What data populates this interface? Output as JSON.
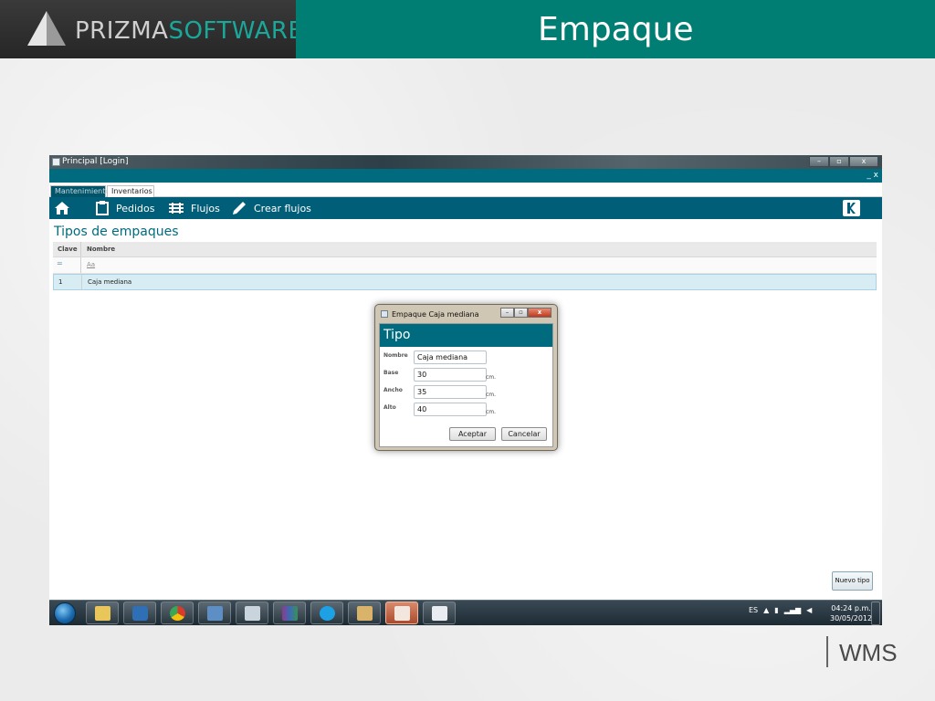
{
  "slide": {
    "logo_prefix": "PRIZMA",
    "logo_accent": "SOFTWARE",
    "title": "Empaque",
    "footer_brand": "WMS",
    "colors": {
      "teal_header": "#007e74",
      "app_teal": "#006b7e",
      "logo_bg": "#2e2e2e"
    }
  },
  "window": {
    "title": "Principal [Login]",
    "mini_controls": "_ x",
    "controls": [
      "minimize-icon",
      "maximize-icon",
      "close-icon"
    ]
  },
  "tabs": [
    {
      "label": "Mantenimiento",
      "active": true
    },
    {
      "label": "Inventarios",
      "active": false
    }
  ],
  "toolbar": {
    "items": [
      {
        "label": "",
        "icon": "home-icon"
      },
      {
        "label": "Pedidos",
        "icon": "clipboard-icon"
      },
      {
        "label": "Flujos",
        "icon": "flow-icon"
      },
      {
        "label": "Crear flujos",
        "icon": "pencil-icon"
      }
    ],
    "exit_icon": "exit-icon"
  },
  "section_title": "Tipos de empaques",
  "grid": {
    "columns": [
      "Clave",
      "Nombre"
    ],
    "filter": {
      "operator": "=",
      "text_filter": "Aa"
    },
    "rows": [
      {
        "clave": "1",
        "nombre": "Caja mediana"
      }
    ]
  },
  "dialog": {
    "title": "Empaque Caja mediana",
    "header": "Tipo",
    "fields": [
      {
        "label": "Nombre",
        "value": "Caja mediana",
        "unit": ""
      },
      {
        "label": "Base",
        "value": "30",
        "unit": "cm."
      },
      {
        "label": "Ancho",
        "value": "35",
        "unit": "cm."
      },
      {
        "label": "Alto",
        "value": "40",
        "unit": "cm."
      }
    ],
    "accept_label": "Aceptar",
    "cancel_label": "Cancelar"
  },
  "new_button_label": "Nuevo tipo",
  "taskbar": {
    "apps": [
      "explorer-icon",
      "media-player-icon",
      "chrome-icon",
      "network-icon",
      "calculator-icon",
      "winrar-icon",
      "skype-icon",
      "tools-icon",
      "powerpoint-icon",
      "app-icon"
    ],
    "language": "ES",
    "time": "04:24 p.m.",
    "date": "30/05/2012"
  }
}
